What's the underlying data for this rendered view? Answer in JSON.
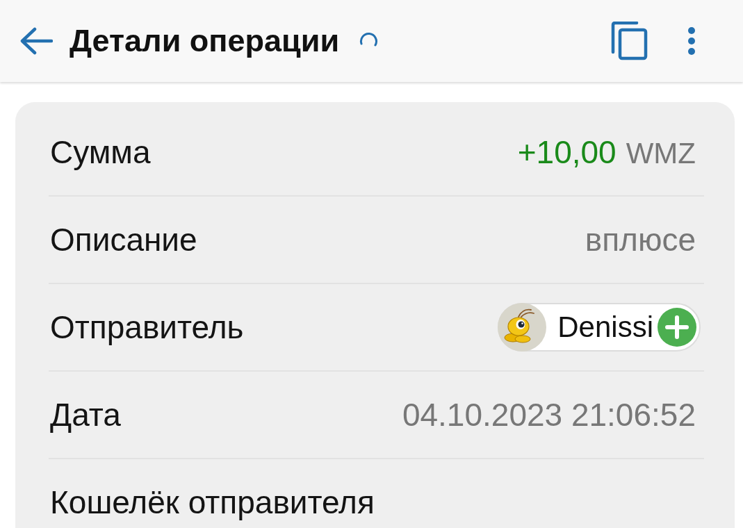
{
  "app_bar": {
    "title": "Детали операции",
    "loading": true
  },
  "details": [
    {
      "kind": "amount",
      "label": "Сумма",
      "amount": "+10,00",
      "currency": "WMZ"
    },
    {
      "kind": "text",
      "label": "Описание",
      "value": "вплюсе"
    },
    {
      "kind": "contact",
      "label": "Отправитель",
      "name": "Denissi"
    },
    {
      "kind": "text",
      "label": "Дата",
      "value": "04.10.2023 21:06:52"
    },
    {
      "kind": "text",
      "label": "Кошелёк отправителя"
    }
  ]
}
